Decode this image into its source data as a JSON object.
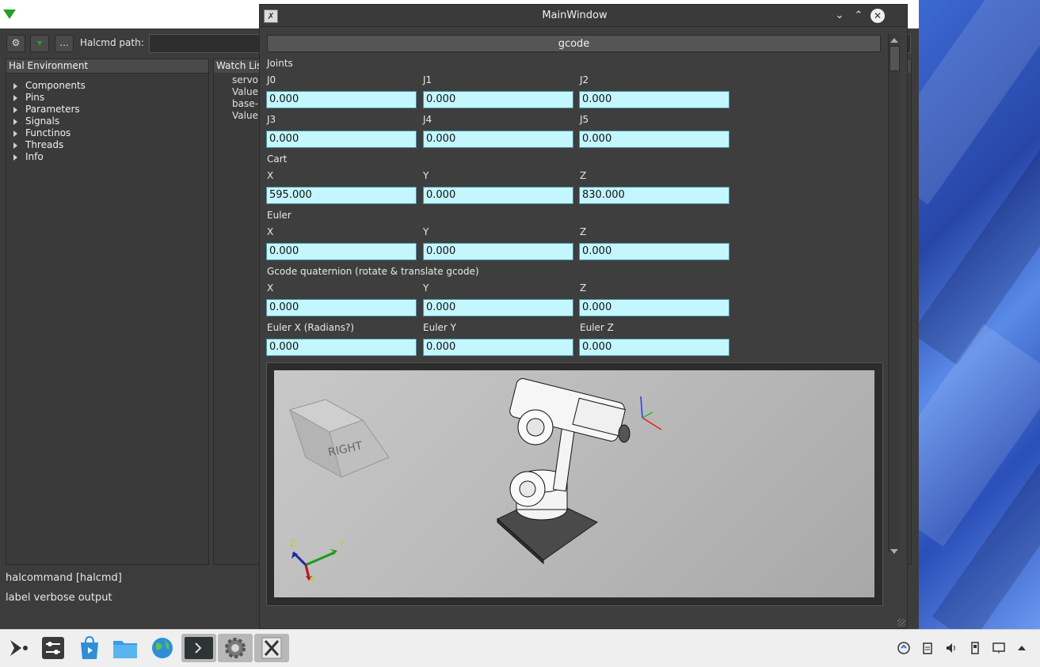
{
  "back_window": {
    "toolbar": {
      "more_label": "...",
      "path_label": "Halcmd path:"
    },
    "tree": {
      "header": "Hal Environment",
      "items": [
        "Components",
        "Pins",
        "Parameters",
        "Signals",
        "Functinos",
        "Threads",
        "Info"
      ]
    },
    "watch": {
      "header": "Watch Lis",
      "items": [
        "servo",
        "Value",
        "base-",
        "Value"
      ]
    },
    "status": {
      "command": "halcommand [halcmd]",
      "verbose": "label verbose output"
    }
  },
  "main_window": {
    "title": "MainWindow",
    "gcode_button": "gcode",
    "sections": {
      "joints": "Joints",
      "cart": "Cart",
      "euler": "Euler",
      "gcode_quat": "Gcode quaternion (rotate & translate gcode)"
    },
    "joints": [
      {
        "label": "J0",
        "value": "0.000"
      },
      {
        "label": "J1",
        "value": "0.000"
      },
      {
        "label": "J2",
        "value": "0.000"
      },
      {
        "label": "J3",
        "value": "0.000"
      },
      {
        "label": "J4",
        "value": "0.000"
      },
      {
        "label": "J5",
        "value": "0.000"
      }
    ],
    "cart": [
      {
        "label": "X",
        "value": "595.000"
      },
      {
        "label": "Y",
        "value": "0.000"
      },
      {
        "label": "Z",
        "value": "830.000"
      }
    ],
    "euler": [
      {
        "label": "X",
        "value": "0.000"
      },
      {
        "label": "Y",
        "value": "0.000"
      },
      {
        "label": "Z",
        "value": "0.000"
      }
    ],
    "gq_pos": [
      {
        "label": "X",
        "value": "0.000"
      },
      {
        "label": "Y",
        "value": "0.000"
      },
      {
        "label": "Z",
        "value": "0.000"
      }
    ],
    "gq_rot": [
      {
        "label": "Euler X (Radians?)",
        "value": "0.000"
      },
      {
        "label": "Euler Y",
        "value": "0.000"
      },
      {
        "label": "Euler Z",
        "value": "0.000"
      }
    ],
    "viewcube_label": "RIGHT",
    "axes": {
      "x": "X",
      "y": "Y",
      "z": "Z"
    }
  }
}
